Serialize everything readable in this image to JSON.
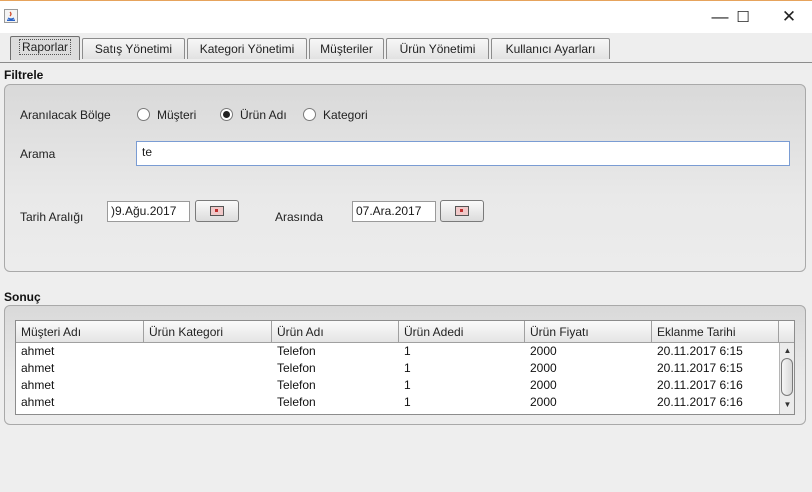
{
  "window": {
    "minimize_glyph": "—",
    "maximize_glyph": "☐",
    "close_glyph": "✕"
  },
  "tabs": [
    {
      "label": "Raporlar",
      "active": true
    },
    {
      "label": "Satış Yönetimi",
      "active": false
    },
    {
      "label": "Kategori Yönetimi",
      "active": false
    },
    {
      "label": "Müşteriler",
      "active": false
    },
    {
      "label": "Ürün Yönetimi",
      "active": false
    },
    {
      "label": "Kullanıcı Ayarları",
      "active": false
    }
  ],
  "filter": {
    "title": "Filtrele",
    "search_area_label": "Aranılacak Bölge",
    "radios": [
      {
        "label": "Müşteri",
        "selected": false
      },
      {
        "label": "Ürün Adı",
        "selected": true
      },
      {
        "label": "Kategori",
        "selected": false
      }
    ],
    "search_label": "Arama",
    "search_value": "te",
    "date_range_label": "Tarih Aralığı",
    "start_date": ")9.Ağu.2017",
    "between_label": "Arasında",
    "end_date": "07.Ara.2017"
  },
  "results": {
    "title": "Sonuç",
    "columns": [
      "Müşteri Adı",
      "Ürün Kategori",
      "Ürün Adı",
      "Ürün Adedi",
      "Ürün Fiyatı",
      "Eklanme Tarihi"
    ],
    "rows": [
      [
        "ahmet",
        "",
        "Telefon",
        "1",
        "2000",
        "20.11.2017 6:15"
      ],
      [
        "ahmet",
        "",
        "Telefon",
        "1",
        "2000",
        "20.11.2017 6:15"
      ],
      [
        "ahmet",
        "",
        "Telefon",
        "1",
        "2000",
        "20.11.2017 6:16"
      ],
      [
        "ahmet",
        "",
        "Telefon",
        "1",
        "2000",
        "20.11.2017 6:16"
      ]
    ]
  },
  "icons": {
    "app": "java-app-icon",
    "calendar": "calendar-icon",
    "scroll_up": "scroll-up-arrow-icon",
    "scroll_down": "scroll-down-arrow-icon"
  }
}
